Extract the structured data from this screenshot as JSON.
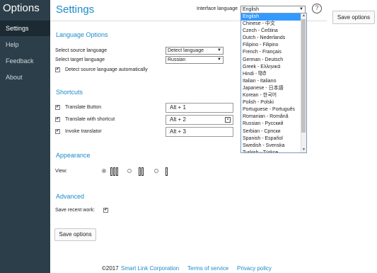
{
  "sidebar": {
    "title": "Options",
    "items": [
      {
        "label": "Settings"
      },
      {
        "label": "Help"
      },
      {
        "label": "Feedback"
      },
      {
        "label": "About"
      }
    ]
  },
  "header": {
    "title": "Settings",
    "interface_language_label": "Interface language",
    "interface_language_value": "English",
    "save_button": "Save options"
  },
  "language_options": {
    "heading": "Language Options",
    "source_label": "Select source language",
    "source_value": "Detect language",
    "target_label": "Select target language",
    "target_value": "Russian",
    "detect_auto_label": "Detect source language automatically"
  },
  "shortcuts": {
    "heading": "Shortcuts",
    "rows": [
      {
        "label": "Translate Button",
        "value": "Alt + 1"
      },
      {
        "label": "Translate with shortcut",
        "value": "Alt + 2"
      },
      {
        "label": "Invoke translator",
        "value": "Alt + 3"
      }
    ]
  },
  "appearance": {
    "heading": "Appearance",
    "view_label": "View:"
  },
  "advanced": {
    "heading": "Advanced",
    "save_recent_label": "Save recent work:"
  },
  "bottom_save_button": "Save options",
  "footer": {
    "copyright": "©2017",
    "company": "Smart Link Corporation",
    "terms": "Terms of service",
    "privacy": "Privacy policy"
  },
  "language_dropdown": {
    "selected": "English",
    "options": [
      "English",
      "Chinese - 中文",
      "Czech - Čeština",
      "Dutch - Nederlands",
      "Filipino - Filipino",
      "French - Français",
      "German - Deutsch",
      "Greek - Ελληνικά",
      "Hindi - हिंदी",
      "Italian - Italiano",
      "Japanese - 日本語",
      "Korean - 한국어",
      "Polish - Polski",
      "Portuguese - Português",
      "Romanian - Română",
      "Russian - Русский",
      "Serbian - Српски",
      "Spanish - Español",
      "Swedish - Svenska",
      "Turkish - Türkçe"
    ]
  },
  "colors": {
    "accent": "#1a8cc9",
    "sidebar_bg": "#2c3e4a",
    "sidebar_active": "#1b2a33",
    "dropdown_selected": "#3399ff"
  }
}
